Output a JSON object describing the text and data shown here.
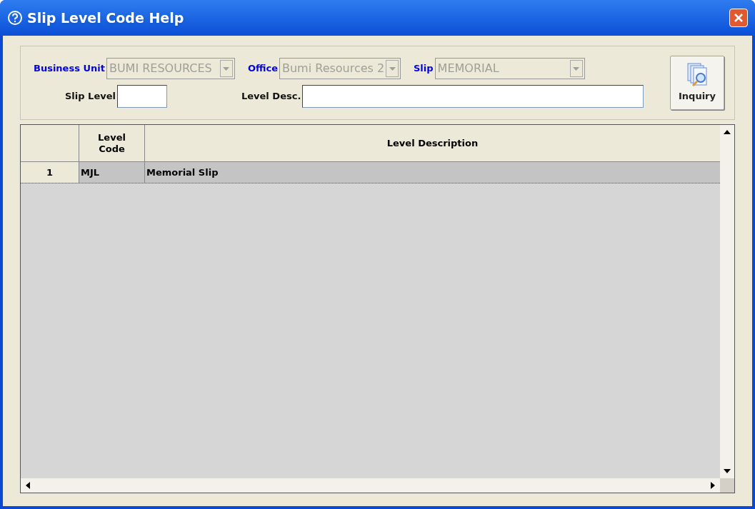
{
  "window": {
    "title": "Slip Level Code Help"
  },
  "filters": [
    {
      "kind": "combo",
      "label": "Business Unit",
      "value": "BUMI RESOURCES",
      "disabled": true
    },
    {
      "kind": "combo",
      "label": "Office",
      "value": "Bumi Resources 2",
      "disabled": true
    },
    {
      "kind": "combo",
      "label": "Slip",
      "value": "MEMORIAL",
      "disabled": true
    },
    {
      "kind": "text",
      "label": "Slip Level"
    },
    {
      "kind": "text",
      "label": "Level Desc."
    }
  ],
  "inquiry_button": {
    "label": "Inquiry"
  },
  "table": {
    "columns": [
      "Level Code",
      "Level Description"
    ],
    "rows": [
      {
        "number": "1",
        "level_code": "MJL",
        "description": "Memorial Slip",
        "selected": true
      }
    ]
  }
}
